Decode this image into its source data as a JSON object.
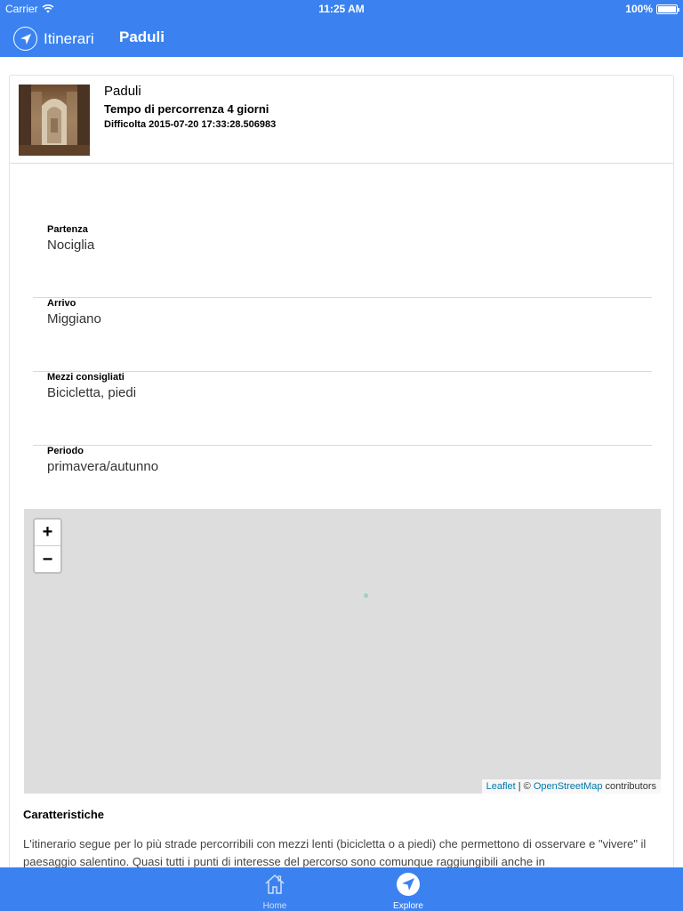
{
  "status_bar": {
    "carrier": "Carrier",
    "time": "11:25 AM",
    "battery": "100%"
  },
  "nav": {
    "back_label": "Itinerari",
    "title": "Paduli"
  },
  "header": {
    "title": "Paduli",
    "subtitle": "Tempo di percorrenza 4 giorni",
    "difficulty": "Difficolta 2015-07-20 17:33:28.506983"
  },
  "info": [
    {
      "label": "Partenza",
      "value": "Nociglia"
    },
    {
      "label": "Arrivo",
      "value": "Miggiano"
    },
    {
      "label": "Mezzi consigliati",
      "value": "Bicicletta, piedi"
    },
    {
      "label": "Periodo",
      "value": "primavera/autunno"
    }
  ],
  "map": {
    "zoom_in": "+",
    "zoom_out": "−",
    "attribution_leaflet": "Leaflet",
    "attribution_sep": " | © ",
    "attribution_osm": "OpenStreetMap",
    "attribution_tail": " contributors"
  },
  "section": {
    "title": "Caratteristiche",
    "description": "L'itinerario segue per lo più strade percorribili con mezzi lenti (bicicletta o a piedi) che permettono di osservare e \"vivere\" il paesaggio salentino. Quasi tutti i punti di interesse del percorso sono comunque raggiungibili anche in"
  },
  "tabs": [
    {
      "label": "Home",
      "icon": "home-icon",
      "active": false
    },
    {
      "label": "Explore",
      "icon": "navigate-icon",
      "active": true
    }
  ],
  "colors": {
    "primary": "#3b82f0",
    "map_bg": "#dddddd",
    "link": "#0078a8"
  }
}
